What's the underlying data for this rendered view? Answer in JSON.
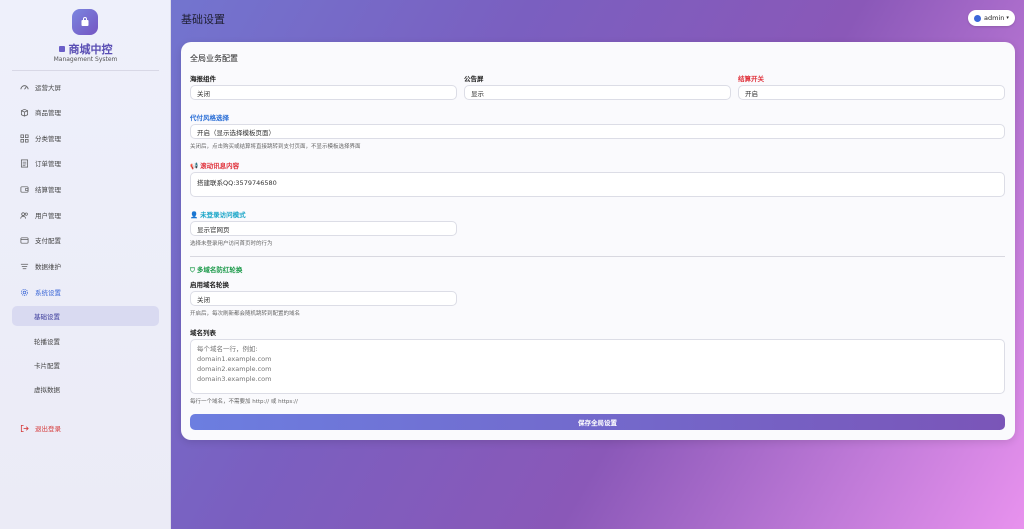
{
  "sidebar": {
    "brand": "商城中控",
    "brand_sub": "Management System",
    "items": [
      {
        "label": "运营大屏",
        "icon": "dashboard-icon"
      },
      {
        "label": "商品管理",
        "icon": "box-icon"
      },
      {
        "label": "分类管理",
        "icon": "grid-icon"
      },
      {
        "label": "订单管理",
        "icon": "list-icon"
      },
      {
        "label": "结算管理",
        "icon": "wallet-icon"
      },
      {
        "label": "用户管理",
        "icon": "users-icon"
      },
      {
        "label": "支付配置",
        "icon": "card-icon"
      },
      {
        "label": "数据维护",
        "icon": "database-icon"
      },
      {
        "label": "系统设置",
        "icon": "gear-icon"
      }
    ],
    "sub_items": [
      {
        "label": "基础设置"
      },
      {
        "label": "轮播设置"
      },
      {
        "label": "卡片配置"
      },
      {
        "label": "虚拟数据"
      }
    ],
    "logout": "退出登录"
  },
  "header": {
    "title": "基础设置",
    "user": "admin"
  },
  "card": {
    "title": "全局业务配置",
    "poster_label": "海报组件",
    "poster_value": "关闭",
    "notice_label": "公告屏",
    "notice_value": "显示",
    "checkout_label": "结算开关",
    "checkout_value": "开启",
    "pay_style_label": "代付风格选择",
    "pay_style_value": "开启（显示选择模板页面）",
    "pay_style_hint": "关闭后，点击购买或结算将直接跳转到支付页面，不显示模板选择界面",
    "marquee_label": "滚动讯息内容",
    "marquee_value": "搭建联系QQ:3579746580",
    "guest_label": "未登录访问模式",
    "guest_value": "显示官网页",
    "guest_hint": "选择未登录用户访问首页时的行为",
    "multi_domain_label": "多域名防红轮换",
    "rotate_label": "启用域名轮换",
    "rotate_value": "关闭",
    "rotate_hint": "开启后，每次刷新都会随机跳转到配置的域名",
    "domain_list_label": "域名列表",
    "domain_placeholder": [
      "每个域名一行，例如:",
      "domain1.example.com",
      "domain2.example.com",
      "domain3.example.com"
    ],
    "domain_hint": "每行一个域名，不需要加 http:// 或 https://",
    "save_label": "保存全局设置"
  }
}
